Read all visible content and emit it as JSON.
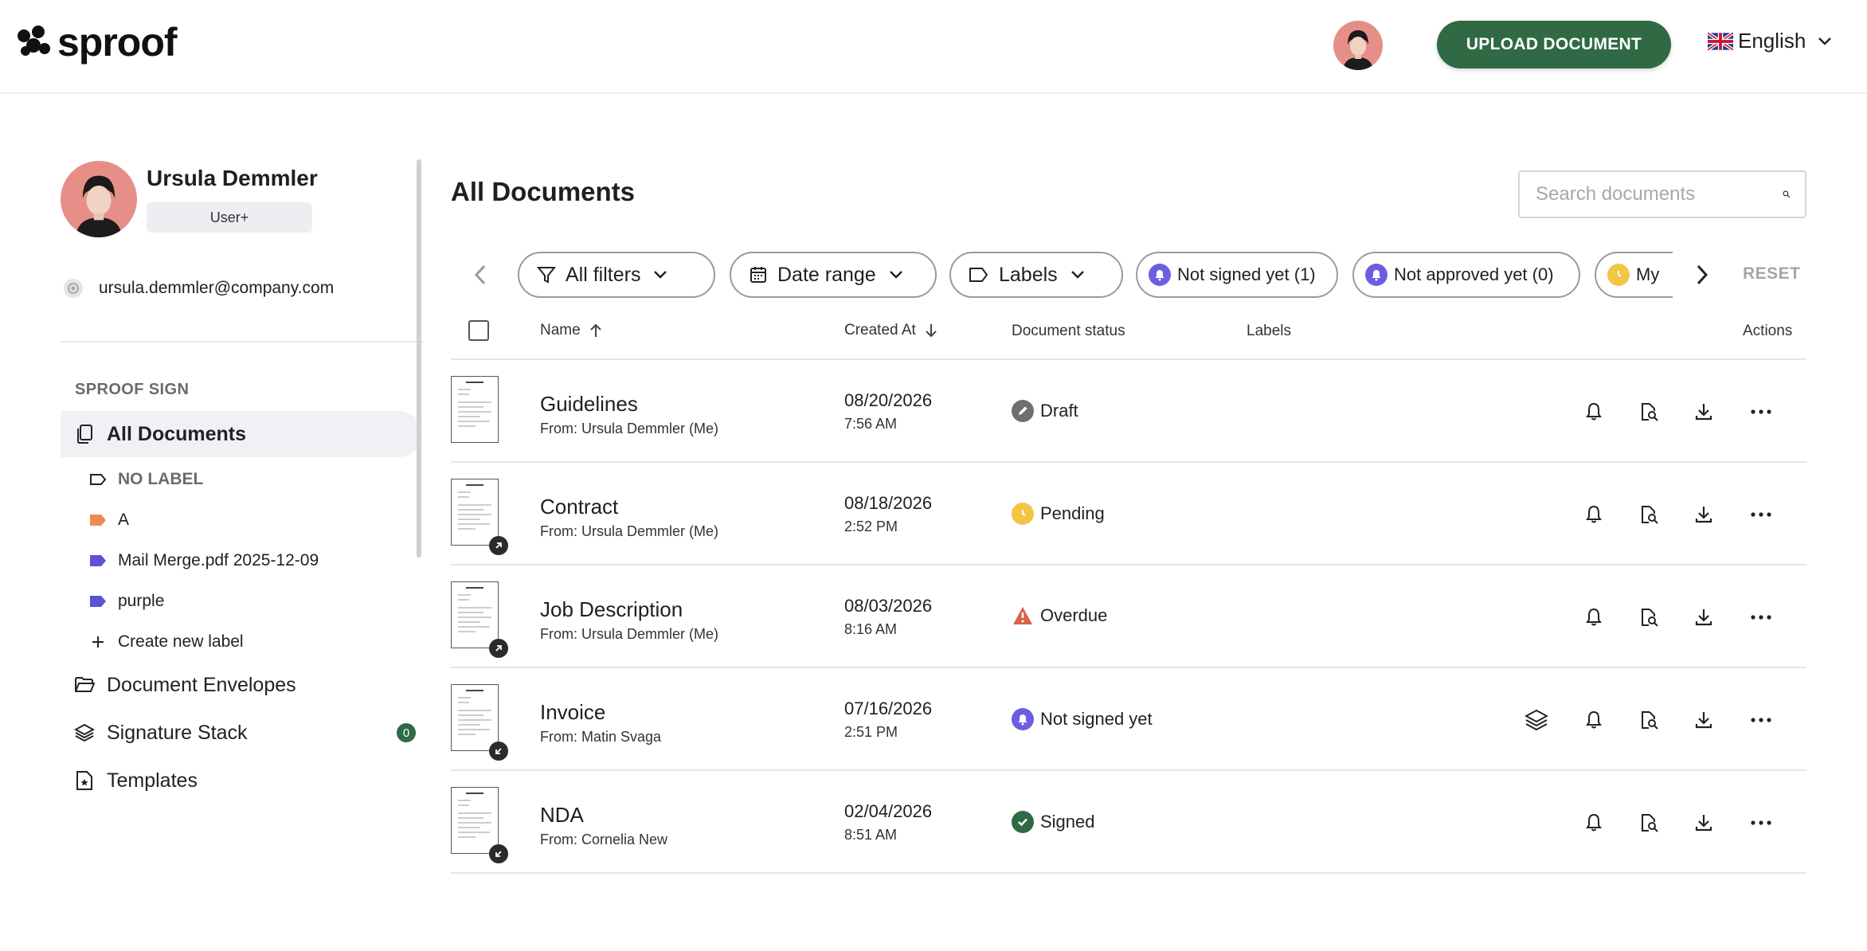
{
  "header": {
    "logo_text": "sproof",
    "upload_label": "UPLOAD DOCUMENT",
    "language": "English"
  },
  "sidebar": {
    "user_name": "Ursula Demmler",
    "user_role": "User+",
    "email": "ursula.demmler@company.com",
    "section_title": "SPROOF SIGN",
    "all_documents": "All Documents",
    "labels": [
      {
        "name": "NO LABEL",
        "color": "none"
      },
      {
        "name": "A",
        "color": "#ef8a57"
      },
      {
        "name": "Mail Merge.pdf 2025-12-09",
        "color": "#5b52d6"
      },
      {
        "name": "purple",
        "color": "#5b52d6"
      }
    ],
    "create_label": "Create new label",
    "document_envelopes": "Document Envelopes",
    "signature_stack": "Signature Stack",
    "signature_stack_count": "0",
    "templates": "Templates"
  },
  "main": {
    "title": "All Documents",
    "search_placeholder": "Search documents",
    "filters": {
      "all_filters": "All filters",
      "date_range": "Date range",
      "labels": "Labels",
      "not_signed": "Not signed yet (1)",
      "not_approved": "Not approved yet (0)",
      "my": "My",
      "reset": "RESET"
    },
    "columns": {
      "name": "Name",
      "created_at": "Created At",
      "status": "Document status",
      "labels": "Labels",
      "actions": "Actions"
    },
    "rows": [
      {
        "name": "Guidelines",
        "from": "From: Ursula Demmler (Me)",
        "date": "08/20/2026",
        "time": "7:56 AM",
        "status": "Draft",
        "badge": "none",
        "stack": false
      },
      {
        "name": "Contract",
        "from": "From: Ursula Demmler (Me)",
        "date": "08/18/2026",
        "time": "2:52 PM",
        "status": "Pending",
        "badge": "outgoing",
        "stack": false
      },
      {
        "name": "Job Description",
        "from": "From: Ursula Demmler (Me)",
        "date": "08/03/2026",
        "time": "8:16 AM",
        "status": "Overdue",
        "badge": "outgoing",
        "stack": false
      },
      {
        "name": "Invoice",
        "from": "From: Matin Svaga",
        "date": "07/16/2026",
        "time": "2:51 PM",
        "status": "Not signed yet",
        "badge": "incoming",
        "stack": true
      },
      {
        "name": "NDA",
        "from": "From: Cornelia New",
        "date": "02/04/2026",
        "time": "8:51 AM",
        "status": "Signed",
        "badge": "incoming",
        "stack": false
      }
    ]
  },
  "colors": {
    "brand_green": "#2f6a44",
    "pending_yellow": "#f3c544",
    "overdue_red": "#d9624a",
    "notsigned_purple": "#6b5fe0",
    "draft_gray": "#6f6f6f",
    "signed_green": "#2f6a44"
  }
}
